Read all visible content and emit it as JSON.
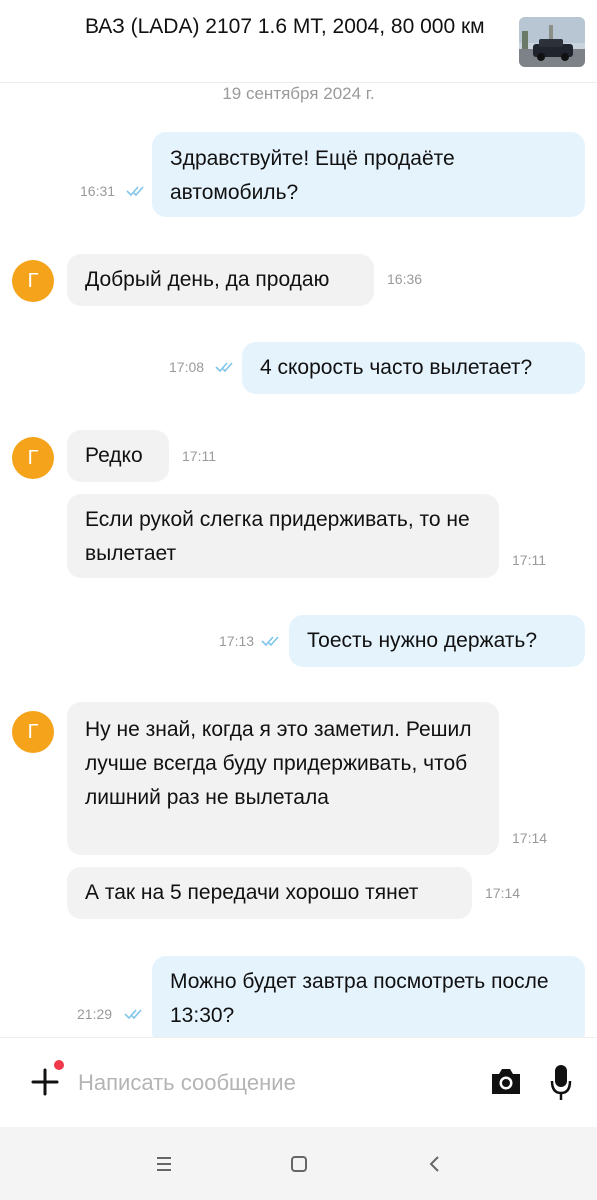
{
  "header": {
    "listing_title": "ВАЗ (LADA) 2107 1.6 MT, 2004, 80 000 км"
  },
  "chat": {
    "date_separator": "19 сентября 2024 г.",
    "messages": [
      {
        "direction": "out",
        "text": "Здравствуйте! Ещё продаёте автомобиль?",
        "time": "16:31",
        "status": "read"
      },
      {
        "direction": "in",
        "avatar_letter": "Г",
        "text": "Добрый день, да продаю",
        "time": "16:36"
      },
      {
        "direction": "out",
        "text": "4 скорость часто вылетает?",
        "time": "17:08",
        "status": "read"
      },
      {
        "direction": "in",
        "avatar_letter": "Г",
        "text": "Редко",
        "time": "17:11"
      },
      {
        "direction": "in",
        "text": "Если рукой слегка придерживать, то не вылетает",
        "time": "17:11"
      },
      {
        "direction": "out",
        "text": "Тоесть нужно держать?",
        "time": "17:13",
        "status": "read"
      },
      {
        "direction": "in",
        "avatar_letter": "Г",
        "text": "Ну не знай, когда я это заметил. Решил лучше всегда буду придерживать, чтоб лишний раз не вылетала",
        "time": "17:14"
      },
      {
        "direction": "in",
        "text": "А так на 5 передачи хорошо тянет",
        "time": "17:14"
      },
      {
        "direction": "out",
        "text": "Можно будет завтра посмотреть после 13:30?",
        "time": "21:29",
        "status": "read"
      }
    ]
  },
  "composer": {
    "placeholder": "Написать сообщение",
    "value": ""
  },
  "colors": {
    "outgoing_bubble": "#e5f3fd",
    "incoming_bubble": "#f2f2f2",
    "avatar": "#f5a31a",
    "read_ticks": "#7fc4ea",
    "notification_dot": "#f0384a"
  },
  "icons": {
    "composer": [
      "plus-icon",
      "camera-icon",
      "microphone-icon"
    ],
    "navbar": [
      "menu-icon",
      "home-icon",
      "back-icon"
    ],
    "message_status": "double-check-icon"
  }
}
